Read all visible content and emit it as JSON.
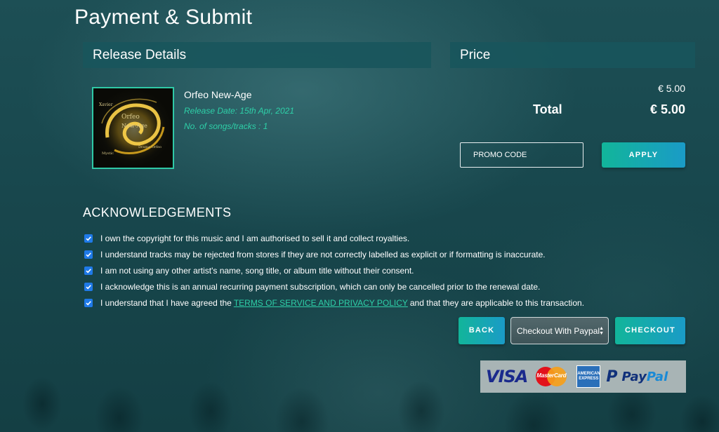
{
  "page": {
    "title": "Payment & Submit"
  },
  "release": {
    "header": "Release Details",
    "cover_text": [
      "Xavier",
      "Orfeo",
      "New-Age",
      "Drama Orfeo",
      "Mystic"
    ],
    "name": "Orfeo New-Age",
    "release_date": "Release Date: 15th Apr, 2021",
    "tracks": "No. of songs/tracks : 1"
  },
  "price": {
    "header": "Price",
    "subtotal": "€ 5.00",
    "total_label": "Total",
    "total_value": "€ 5.00",
    "promo_placeholder": "PROMO CODE",
    "apply_label": "APPLY"
  },
  "acknowledgements": {
    "title": "ACKNOWLEDGEMENTS",
    "items": [
      "I own the copyright for this music and I am authorised to sell it and collect royalties.",
      "I understand tracks may be rejected from stores if they are not correctly labelled as explicit or if formatting is inaccurate.",
      "I am not using any other artist's name, song title, or album title without their consent.",
      "I acknowledge this is an annual recurring payment subscription, which can only be cancelled prior to the renewal date."
    ],
    "last_item": {
      "before": "I understand that I have agreed the",
      "link": "TERMS OF SERVICE AND PRIVACY POLICY",
      "after": "and that they are applicable to this transaction."
    },
    "checked": [
      true,
      true,
      true,
      true,
      true
    ]
  },
  "actions": {
    "back_label": "BACK",
    "payment_method": "Checkout With Paypal",
    "checkout_label": "CHECKOUT"
  },
  "payment_logos": {
    "visa": "VISA",
    "mastercard": "MasterCard",
    "amex": "AMERICAN EXPRESS",
    "paypal_a": "Pay",
    "paypal_b": "Pal"
  },
  "colors": {
    "accent": "#2ed0a8",
    "button_start": "#12b59a",
    "button_end": "#1a9bc7",
    "checkbox": "#1f7ae8",
    "header_bg": "#18555c"
  }
}
